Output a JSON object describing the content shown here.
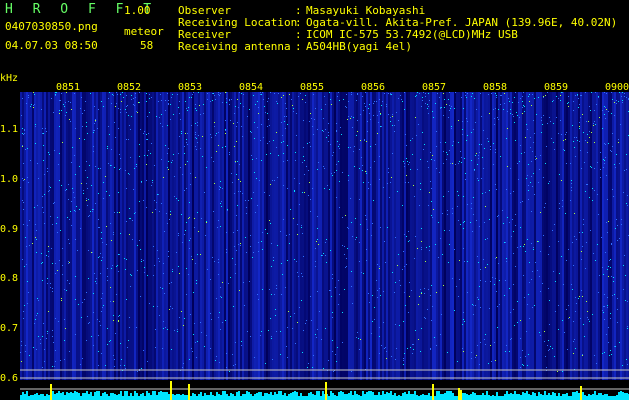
{
  "app": {
    "name": "H R O F F T",
    "version": "1.00"
  },
  "file": {
    "name": "0407030850.png",
    "datetime": "04.07.03 08:50"
  },
  "detection": {
    "mode": "meteor",
    "count": "58"
  },
  "info": [
    {
      "key": "Observer",
      "sep": ":",
      "value": "Masayuki Kobayashi"
    },
    {
      "key": "Receiving Location",
      "sep": ":",
      "value": "Ogata-vill. Akita-Pref. JAPAN (139.96E, 40.02N)"
    },
    {
      "key": "Receiver",
      "sep": ":",
      "value": "ICOM IC-575 53.7492(@LCD)MHz USB"
    },
    {
      "key": "Receiving antenna",
      "sep": ":",
      "value": "A504HB(yagi 4el)"
    }
  ],
  "axis": {
    "unit": "kHz",
    "freq_labels": [
      "1.1",
      "1.0",
      "0.9",
      "0.8",
      "0.7",
      "0.6"
    ],
    "time_labels": [
      "0851",
      "0852",
      "0853",
      "0854",
      "0855",
      "0856",
      "0857",
      "0858",
      "0859",
      "0900"
    ]
  },
  "colors": {
    "background": "#000000",
    "text": "#ffff00",
    "title": "#66ff66",
    "noise_base": "#0a1a8c",
    "noise_hot": "#00e0ff"
  }
}
